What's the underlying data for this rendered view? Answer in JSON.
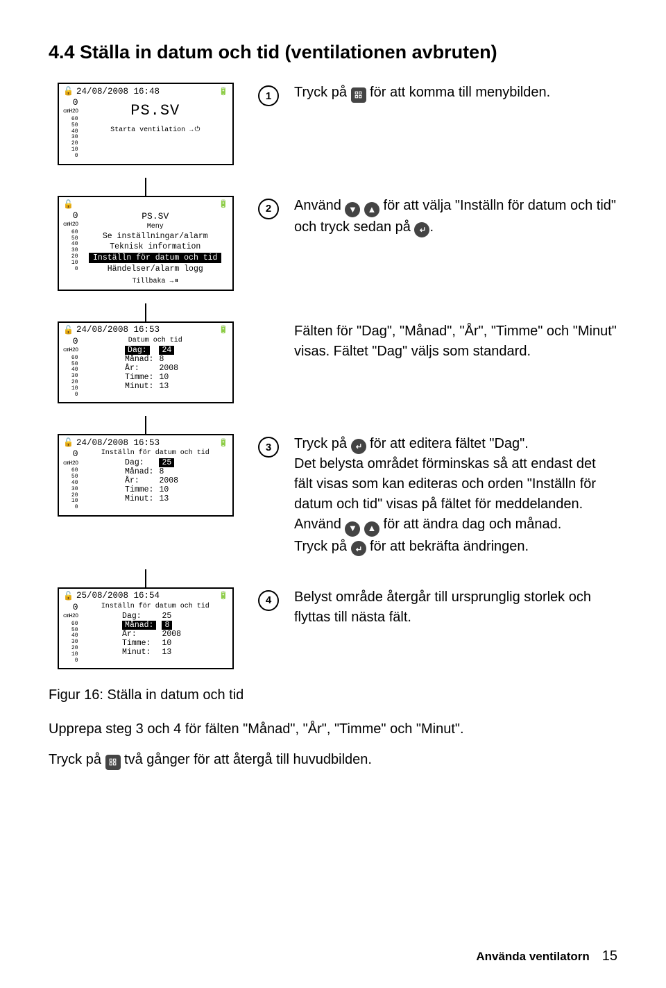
{
  "heading": "4.4  Ställa in datum och tid (ventilationen avbruten)",
  "yaxis": {
    "zero": "0",
    "unit": "cmH2O",
    "ticks": [
      "60",
      "50",
      "40",
      "30",
      "20",
      "10",
      "0"
    ]
  },
  "screens": {
    "s1": {
      "timestamp": "24/08/2008  16:48",
      "psv": "PS.SV",
      "footer": "Starta ventilation",
      "footer_icons": "→⏻"
    },
    "s2": {
      "title1": "PS.SV",
      "title2": "Meny",
      "items": [
        "Se inställningar/alarm",
        "Teknisk information",
        "Inställn för datum och tid",
        "Händelser/alarm logg"
      ],
      "highlight_index": 2,
      "footer": "Tillbaka",
      "footer_icons": "→⏸"
    },
    "s3": {
      "timestamp": "24/08/2008  16:53",
      "subtitle": "Datum och tid",
      "rows": [
        {
          "label": "Dag:",
          "value": "24",
          "hl": "row"
        },
        {
          "label": "Månad:",
          "value": "8"
        },
        {
          "label": "År:",
          "value": "2008"
        },
        {
          "label": "Timme:",
          "value": "10"
        },
        {
          "label": "Minut:",
          "value": "13"
        }
      ]
    },
    "s4": {
      "timestamp": "24/08/2008  16:53",
      "subtitle": "Inställn för datum och tid",
      "rows": [
        {
          "label": "Dag:",
          "value": "25",
          "hl": "value"
        },
        {
          "label": "Månad:",
          "value": "8"
        },
        {
          "label": "År:",
          "value": "2008"
        },
        {
          "label": "Timme:",
          "value": "10"
        },
        {
          "label": "Minut:",
          "value": "13"
        }
      ]
    },
    "s5": {
      "timestamp": "25/08/2008  16:54",
      "subtitle": "Inställn för datum och tid",
      "rows": [
        {
          "label": "Dag:",
          "value": "25"
        },
        {
          "label": "Månad:",
          "value": "8",
          "hl": "row"
        },
        {
          "label": "År:",
          "value": "2008"
        },
        {
          "label": "Timme:",
          "value": "10"
        },
        {
          "label": "Minut:",
          "value": "13"
        }
      ]
    }
  },
  "steps": {
    "s1": {
      "num": "1",
      "pre": "Tryck på ",
      "post": " för att komma till menybilden."
    },
    "s2": {
      "num": "2",
      "pre": "Använd ",
      "mid": " för att välja \"Inställn för datum och tid\" och tryck sedan på ",
      "post": "."
    },
    "s3": {
      "text": "Fälten för \"Dag\", \"Månad\", \"År\", \"Timme\" och \"Minut\" visas. Fältet \"Dag\" väljs som standard."
    },
    "s4": {
      "num": "3",
      "l1a": "Tryck på ",
      "l1b": " för att editera fältet \"Dag\".",
      "l2a": "Det belysta området förminskas så att endast det fält visas som kan editeras och orden \"Inställn för datum och tid\" visas på fältet för meddelanden. Använd ",
      "l2b": " för att ändra dag och månad.",
      "l3a": "Tryck på ",
      "l3b": " för att bekräfta ändringen."
    },
    "s5": {
      "num": "4",
      "text": "Belyst område återgår till ursprunglig storlek och flyttas till nästa fält."
    }
  },
  "caption": "Figur 16: Ställa in datum och tid",
  "bottom1_a": "Upprepa steg 3 och 4 för fälten \"Månad\", \"År\", \"Timme\" och \"Minut\".",
  "bottom2_a": "Tryck på ",
  "bottom2_b": " två gånger för att återgå till huvudbilden.",
  "footer": {
    "section": "Använda ventilatorn",
    "page": "15"
  }
}
